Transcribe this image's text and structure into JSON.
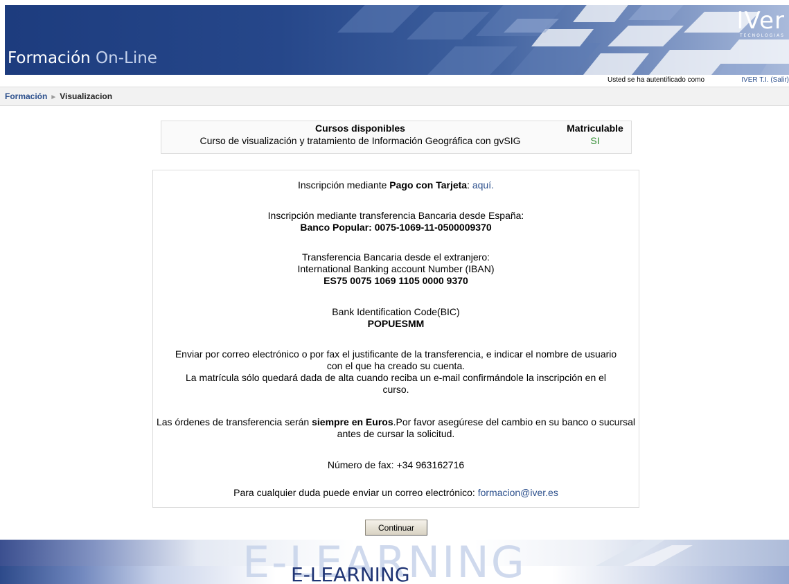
{
  "header": {
    "title_main": "Formación",
    "title_light": "On-Line",
    "brand_name": "IVer",
    "brand_sub": "TECNOLOGIAS"
  },
  "login": {
    "text": "Usted se ha autentificado como",
    "user": "IVER T.I.",
    "logout": "(Salir)"
  },
  "breadcrumb": {
    "home": "Formación",
    "separator": "►",
    "current": "Visualizacion"
  },
  "courses": {
    "header_course": "Cursos disponibles",
    "header_enrol": "Matriculable",
    "rows": [
      {
        "course": "Curso de visualización y tratamiento de Información Geográfica con gvSIG",
        "enrol": "SI"
      }
    ]
  },
  "payment": {
    "card_prefix": "Inscripción mediante ",
    "card_bold": "Pago con Tarjeta",
    "card_colon": ": ",
    "card_link": "aquí.",
    "spain_line": "Inscripción mediante transferencia Bancaria desde España:",
    "spain_account": "Banco Popular: 0075-1069-11-0500009370",
    "foreign_line": "Transferencia Bancaria desde el extranjero:",
    "iban_label": "International Banking account Number (IBAN)",
    "iban_value": "ES75 0075 1069 1105 0000 9370",
    "bic_label": "Bank Identification Code(BIC)",
    "bic_value": "POPUESMM",
    "email_instructions_1": "Enviar por correo electrónico o por fax el justificante de la transferencia, e indicar el nombre de usuario con el que ha creado su cuenta.",
    "email_instructions_2": "La matrícula sólo quedará dada de alta cuando reciba un e-mail confirmándole la inscripción en el curso.",
    "currency_prefix": "Las órdenes de transferencia serán ",
    "currency_bold": "siempre en Euros",
    "currency_suffix": ".Por favor asegúrese del cambio en su banco o sucursal antes de cursar la solicitud.",
    "fax": "Número de fax: +34 963162716",
    "contact_prefix": "Para cualquier duda puede enviar un correo electrónico: ",
    "contact_email": "formacion@iver.es"
  },
  "actions": {
    "continue_label": "Continuar"
  },
  "footer": {
    "watermark": "E-LEARNING",
    "label": "E-LEARNING"
  },
  "colors": {
    "header_blue": "#1d3c7e",
    "link_blue": "#2b4f8c",
    "enrol_green": "#2e8b2e"
  }
}
